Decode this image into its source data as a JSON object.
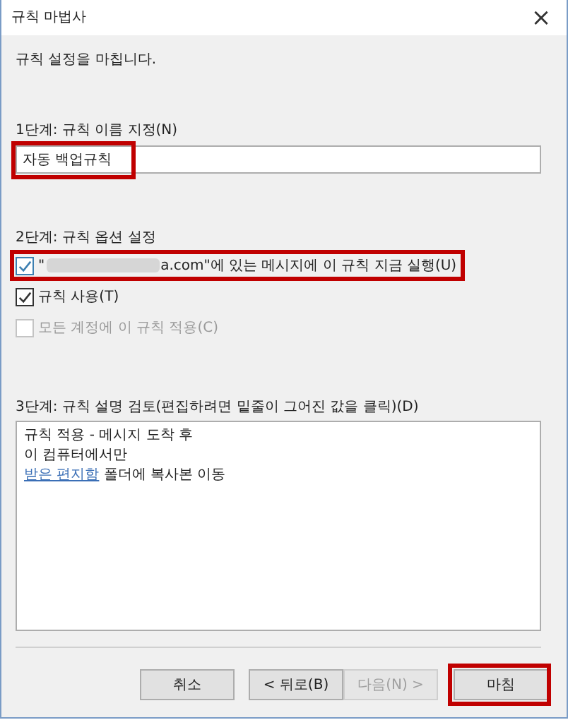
{
  "window": {
    "title": "규칙 마법사",
    "close": "×"
  },
  "intro": "규칙 설정을 마칩니다.",
  "step1": {
    "label": "1단계: 규칙 이름 지정(N)",
    "value": "자동 백업규칙",
    "highlighted": true
  },
  "step2": {
    "label": "2단계: 규칙 옵션 설정",
    "options": [
      {
        "kind": "redacted",
        "label_start": "\"",
        "label_end": "a.com\"에 있는 메시지에 이 규칙 지금 실행(U)",
        "checked": true,
        "disabled": false,
        "highlighted": true
      },
      {
        "kind": "plain",
        "label": "규칙 사용(T)",
        "checked": true,
        "disabled": false,
        "highlighted": false
      },
      {
        "kind": "plain",
        "label": "모든 계정에 이 규칙 적용(C)",
        "checked": false,
        "disabled": true,
        "highlighted": false
      }
    ]
  },
  "step3": {
    "label": "3단계: 규칙 설명 검토(편집하려면 밑줄이 그어진 값을 클릭)(D)",
    "lines": [
      {
        "kind": "text",
        "text": "규칙 적용 - 메시지 도착 후"
      },
      {
        "kind": "text",
        "text": "이 컴퓨터에서만"
      },
      {
        "kind": "link",
        "link": "받은 편지함",
        "text": "폴더에 복사본 이동"
      }
    ]
  },
  "buttons": [
    {
      "label": "취소",
      "disabled": false,
      "highlighted": false
    },
    {
      "label": "< 뒤로(B)",
      "disabled": false,
      "highlighted": false
    },
    {
      "label": "다음(N) >",
      "disabled": true,
      "highlighted": false
    },
    {
      "label": "마침",
      "disabled": false,
      "highlighted": true
    }
  ]
}
